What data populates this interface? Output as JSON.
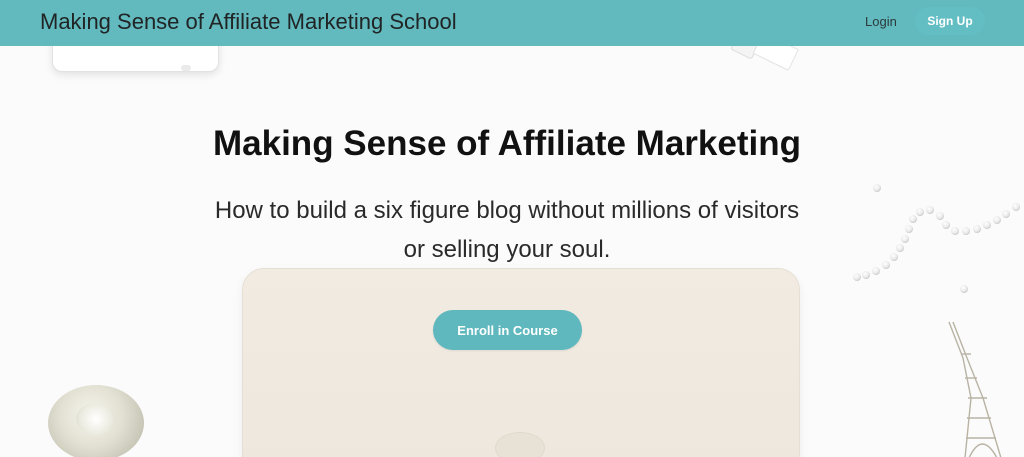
{
  "header": {
    "site_title": "Making Sense of Affiliate Marketing School",
    "login_label": "Login",
    "signup_label": "Sign Up"
  },
  "hero": {
    "title": "Making Sense of Affiliate Marketing",
    "subtitle": "How to build a six figure blog without millions of visitors or selling your soul.",
    "enroll_label": "Enroll in Course"
  },
  "colors": {
    "header_bg": "#5db8bd",
    "button_bg": "#5fb8bd",
    "page_bg": "#fbfbfb"
  },
  "decor": {
    "items": [
      "phone-image",
      "bottle-image",
      "laptop-image",
      "pearl-necklace-image",
      "rose-image",
      "eiffel-tower-image"
    ]
  }
}
